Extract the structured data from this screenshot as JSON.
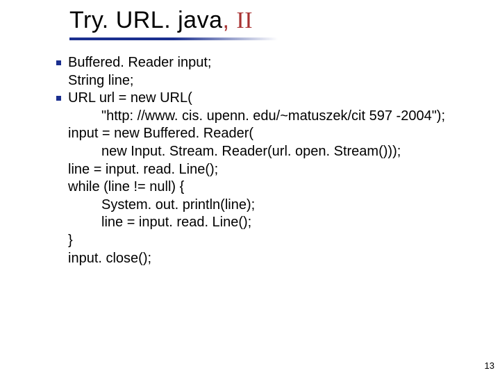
{
  "title": {
    "main": "Try. URL. java",
    "sep": ", ",
    "roman": "II"
  },
  "code": {
    "b1l1": "Buffered. Reader input;",
    "b1l2": "String line;",
    "b2l1": "URL url = new URL(",
    "b2l2": "\"http: //www. cis. upenn. edu/~matuszek/cit 597 -2004\");",
    "b2l3": "input = new Buffered. Reader(",
    "b2l4": "new Input. Stream. Reader(url. open. Stream()));",
    "b2l5": "line = input. read. Line();",
    "b2l6": "while (line != null) {",
    "b2l7": "System. out. println(line);",
    "b2l8": "line = input. read. Line();",
    "b2l9": "}",
    "b2l10": "input. close();"
  },
  "page": "13"
}
